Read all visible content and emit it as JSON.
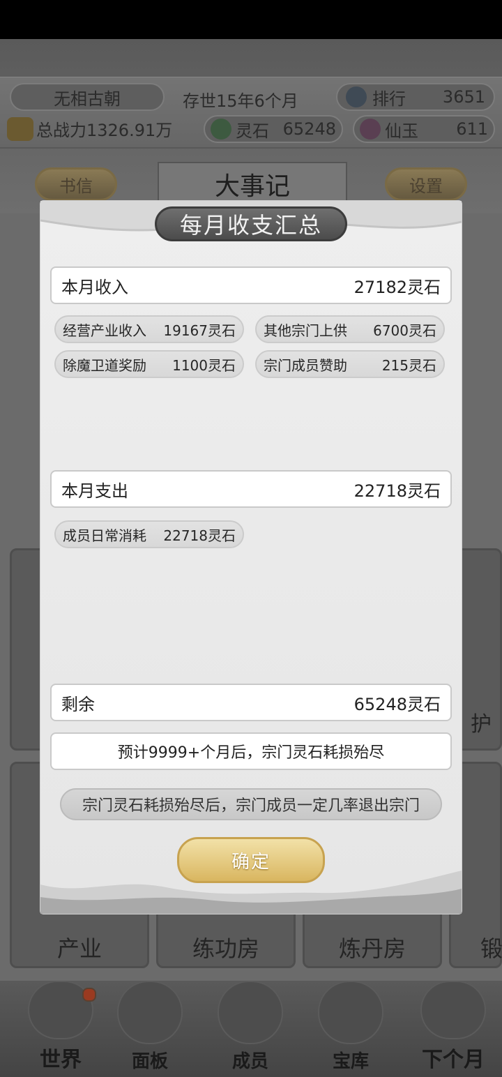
{
  "topbar": {
    "sect_name": "无相古朝",
    "existence": "存世15年6个月",
    "rank_label": "排行",
    "rank_value": "3651",
    "power": "总战力1326.91万",
    "spirit_stone_label": "灵石",
    "spirit_stone_value": "65248",
    "jade_label": "仙玉",
    "jade_value": "611"
  },
  "header": {
    "letter_button": "书信",
    "title": "大事记",
    "settings_button": "设置"
  },
  "background_text": {
    "right_edge_char": "护"
  },
  "buildings": [
    "产业",
    "练功房",
    "炼丹房",
    "锻"
  ],
  "bottom_nav": [
    "世界",
    "面板",
    "成员",
    "宝库",
    "下个月"
  ],
  "modal": {
    "title": "每月收支汇总",
    "income": {
      "label": "本月收入",
      "value": "27182灵石"
    },
    "income_items": [
      {
        "label": "经营产业收入",
        "value": "19167灵石"
      },
      {
        "label": "其他宗门上供",
        "value": "6700灵石"
      },
      {
        "label": "除魔卫道奖励",
        "value": "1100灵石"
      },
      {
        "label": "宗门成员赞助",
        "value": "215灵石"
      }
    ],
    "expense": {
      "label": "本月支出",
      "value": "22718灵石"
    },
    "expense_items": [
      {
        "label": "成员日常消耗",
        "value": "22718灵石"
      }
    ],
    "remaining": {
      "label": "剩余",
      "value": "65248灵石"
    },
    "forecast": "预计9999+个月后，宗门灵石耗损殆尽",
    "warning": "宗门灵石耗损殆尽后，宗门成员一定几率退出宗门",
    "confirm_button": "确定"
  }
}
